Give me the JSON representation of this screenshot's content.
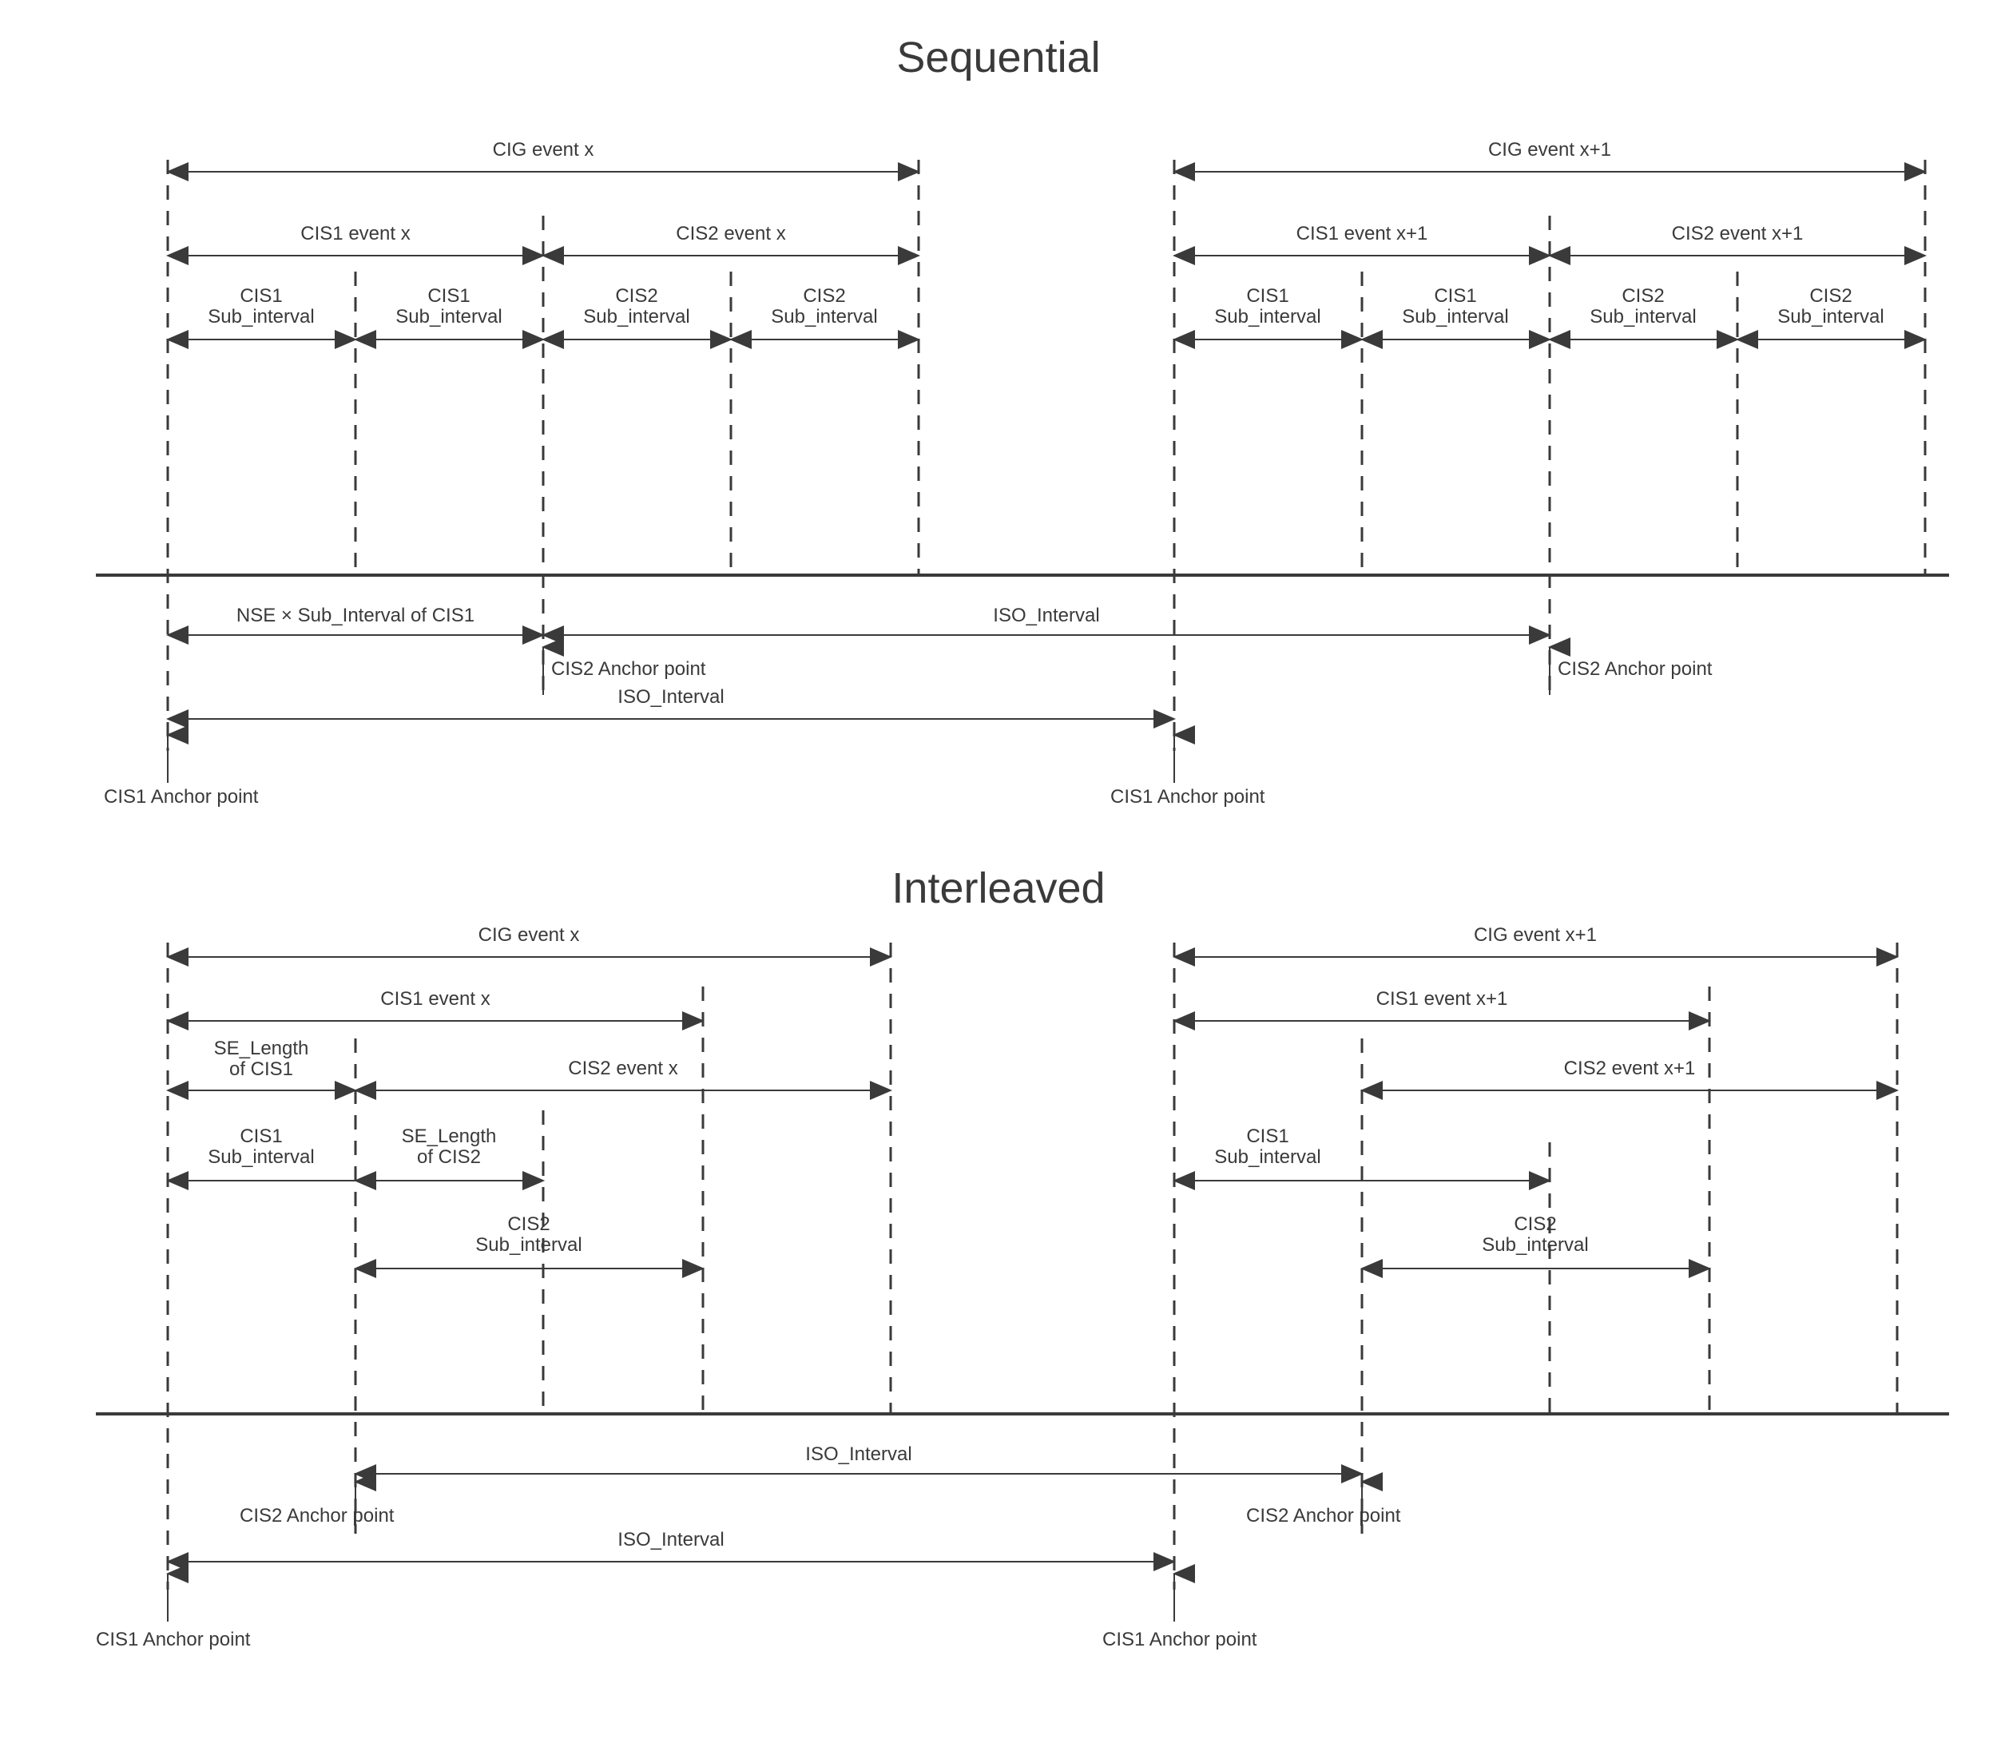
{
  "sequential": {
    "title": "Sequential",
    "cig_x": "CIG event x",
    "cig_x1": "CIG event x+1",
    "cis1_x": "CIS1 event x",
    "cis2_x": "CIS2 event x",
    "cis1_x1": "CIS1 event x+1",
    "cis2_x1": "CIS2 event x+1",
    "cis1_sub": "CIS1\nSub_interval",
    "cis2_sub": "CIS2\nSub_interval",
    "nse": "NSE × Sub_Interval of CIS1",
    "iso": "ISO_Interval",
    "cis2_anchor": "CIS2 Anchor point",
    "cis1_anchor": "CIS1 Anchor point"
  },
  "interleaved": {
    "title": "Interleaved",
    "cig_x": "CIG event x",
    "cig_x1": "CIG event x+1",
    "cis1_x": "CIS1 event x",
    "cis1_x1": "CIS1 event x+1",
    "cis2_x": "CIS2 event x",
    "cis2_x1": "CIS2 event x+1",
    "se1": "SE_Length\nof CIS1",
    "se2": "SE_Length\nof CIS2",
    "cis1_sub": "CIS1\nSub_interval",
    "cis2_sub": "CIS2\nSub_interval",
    "iso": "ISO_Interval",
    "cis2_anchor": "CIS2 Anchor point",
    "cis1_anchor": "CIS1 Anchor point"
  }
}
